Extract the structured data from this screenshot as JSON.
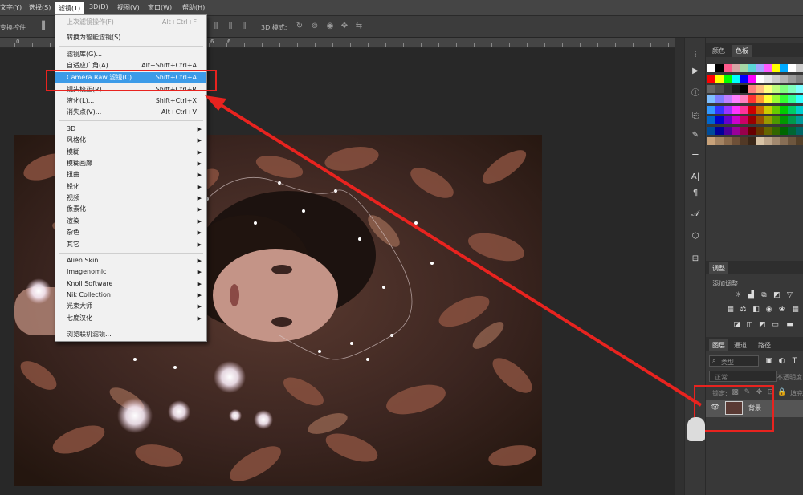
{
  "menubar": {
    "items": [
      "文字(Y)",
      "选择(S)",
      "滤镜(T)",
      "3D(D)",
      "视图(V)",
      "窗口(W)",
      "帮助(H)"
    ]
  },
  "optionsbar": {
    "transform_label": "变换控件",
    "mode_label": "3D 模式:"
  },
  "ruler": {
    "marks": [
      "0",
      "6",
      "6"
    ]
  },
  "filter_menu": {
    "last_filter": {
      "label": "上次滤镜操作(F)",
      "shortcut": "Alt+Ctrl+F"
    },
    "smart": {
      "label": "转换为智能滤镜(S)"
    },
    "gallery": {
      "label": "滤镜库(G)..."
    },
    "adaptive_wide": {
      "label": "自适应广角(A)...",
      "shortcut": "Alt+Shift+Ctrl+A"
    },
    "camera_raw": {
      "label": "Camera Raw 滤镜(C)...",
      "shortcut": "Shift+Ctrl+A"
    },
    "lens_correction": {
      "label": "镜头校正(R)...",
      "shortcut": "Shift+Ctrl+R"
    },
    "liquify": {
      "label": "液化(L)...",
      "shortcut": "Shift+Ctrl+X"
    },
    "vanishing": {
      "label": "消失点(V)...",
      "shortcut": "Alt+Ctrl+V"
    },
    "submenus": [
      "3D",
      "风格化",
      "模糊",
      "模糊画廊",
      "扭曲",
      "锐化",
      "视频",
      "像素化",
      "渲染",
      "杂色",
      "其它"
    ],
    "plugins": [
      "Alien Skin",
      "Imagenomic",
      "Knoll Software",
      "Nik Collection",
      "光束大师",
      "七度汉化"
    ],
    "browse_online": {
      "label": "浏览联机滤镜..."
    }
  },
  "right_panel": {
    "swatch_tabs": [
      "颜色",
      "色板"
    ],
    "adjust_tab": "调整",
    "adjust_add_label": "添加调整",
    "layers_tabs": [
      "图层",
      "通道",
      "路径"
    ],
    "search_kind": "类型",
    "blend_mode": "正常",
    "opacity_label": "不透明度",
    "lock_label": "锁定:",
    "fill_label": "填充",
    "layer_name": "背景"
  },
  "colors": {
    "menubar_bg": "#454545",
    "canvas_bg": "#282828",
    "menu_bg": "#f1f1f1",
    "menu_highlight": "#3c9be8",
    "annotation_red": "#e8231f",
    "panel_bg": "#383838"
  },
  "icons": [
    "play-icon",
    "info-icon",
    "brush-preset-icon",
    "character-icon",
    "paragraph-icon",
    "glyph-icon",
    "3d-icon",
    "properties-icon",
    "eye-icon",
    "lock-icon",
    "search-icon"
  ],
  "swatches": [
    [
      "#ffffff",
      "#000000",
      "#ff5a8c",
      "#d7a5a5",
      "#a5d7a5",
      "#5ad7d7",
      "#a5a5ff",
      "#ff5aff",
      "#ffff00",
      "#00aaff",
      "#ffffff",
      "#cccccc"
    ],
    [
      "#ff0000",
      "#ffff00",
      "#00ff00",
      "#00ffff",
      "#0000ff",
      "#ff00ff",
      "#ffffff",
      "#e6e6e6",
      "#cccccc",
      "#b3b3b3",
      "#999999",
      "#808080"
    ],
    [
      "#666666",
      "#4d4d4d",
      "#333333",
      "#1a1a1a",
      "#000000",
      "#ff7f7f",
      "#ffbf7f",
      "#ffff7f",
      "#bfff7f",
      "#7fff7f",
      "#7fffbf",
      "#7fffff"
    ],
    [
      "#7fbfff",
      "#7f7fff",
      "#bf7fff",
      "#ff7fff",
      "#ff7fbf",
      "#ff3333",
      "#ff9933",
      "#ffff33",
      "#99ff33",
      "#33ff33",
      "#33ff99",
      "#33ffff"
    ],
    [
      "#3399ff",
      "#3333ff",
      "#9933ff",
      "#ff33ff",
      "#ff3399",
      "#cc0000",
      "#cc6600",
      "#cccc00",
      "#66cc00",
      "#00cc00",
      "#00cc66",
      "#00cccc"
    ],
    [
      "#0066cc",
      "#0000cc",
      "#6600cc",
      "#cc00cc",
      "#cc0066",
      "#990000",
      "#994c00",
      "#999900",
      "#4c9900",
      "#009900",
      "#00994c",
      "#009999"
    ],
    [
      "#004c99",
      "#000099",
      "#4c0099",
      "#990099",
      "#99004c",
      "#660000",
      "#663300",
      "#666600",
      "#336600",
      "#006600",
      "#006633",
      "#006666"
    ],
    [
      "#c8a27a",
      "#a58463",
      "#8a6a4c",
      "#6e5038",
      "#523926",
      "#3a2718",
      "#d8c3a5",
      "#bda58a",
      "#a2896f",
      "#876e55",
      "#6d563e",
      "#544029"
    ]
  ]
}
